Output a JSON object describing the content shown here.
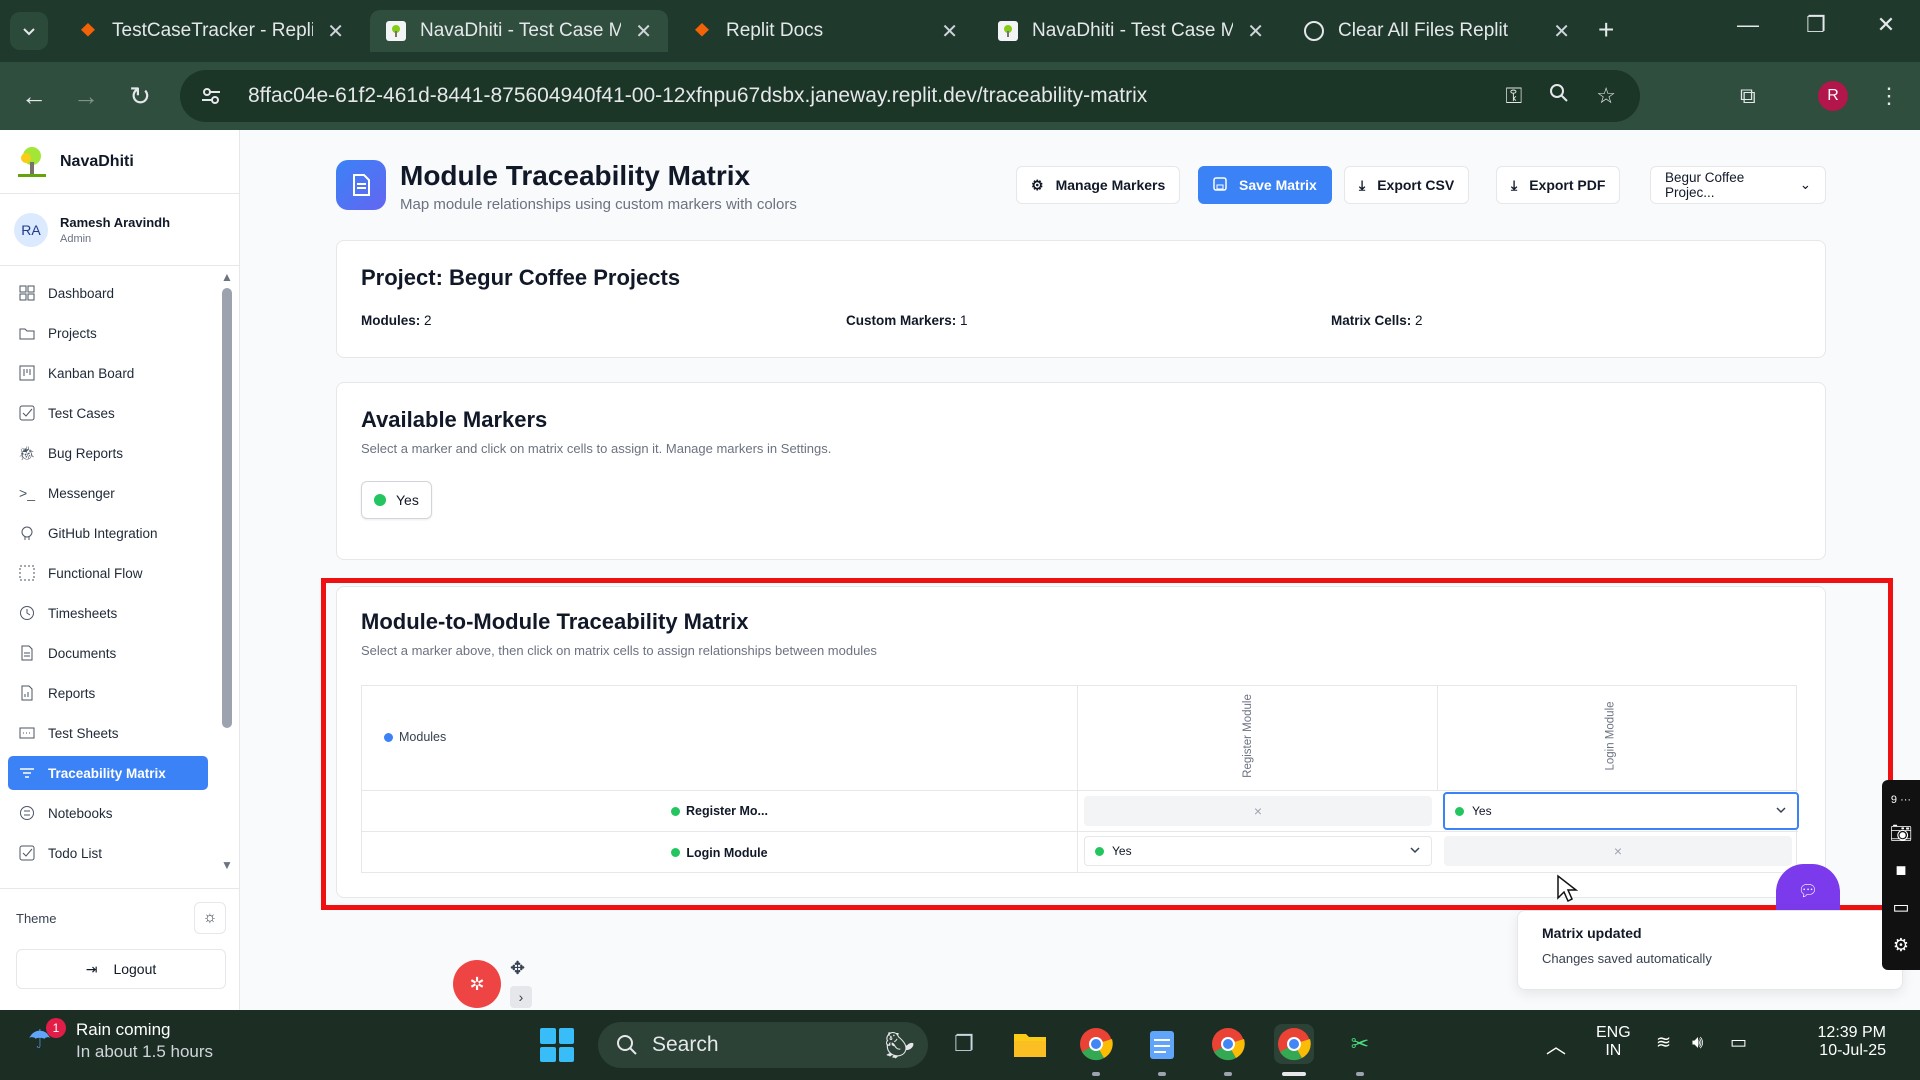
{
  "browser": {
    "tabs": [
      {
        "title": "TestCaseTracker - Replit",
        "favicon": "replit-icon"
      },
      {
        "title": "NavaDhiti - Test Case Ma",
        "favicon": "navadhiti-icon",
        "active": true
      },
      {
        "title": "Replit Docs",
        "favicon": "replit-icon"
      },
      {
        "title": "NavaDhiti - Test Case Ma",
        "favicon": "navadhiti-icon"
      },
      {
        "title": "Clear All Files Replit",
        "favicon": "chatgpt-icon"
      }
    ],
    "url": "8ffac04e-61f2-461d-8441-875604940f41-00-12xfnpu67dsbx.janeway.replit.dev/traceability-matrix",
    "profile_initial": "R"
  },
  "sidebar": {
    "brand": "NavaDhiti",
    "user": {
      "initials": "RA",
      "name": "Ramesh Aravindh",
      "role": "Admin"
    },
    "items": [
      {
        "label": "Dashboard",
        "icon": "grid-icon"
      },
      {
        "label": "Projects",
        "icon": "folder-icon"
      },
      {
        "label": "Kanban Board",
        "icon": "kanban-icon"
      },
      {
        "label": "Test Cases",
        "icon": "checkbox-icon"
      },
      {
        "label": "Bug Reports",
        "icon": "bug-icon"
      },
      {
        "label": "Messenger",
        "icon": "terminal-icon"
      },
      {
        "label": "GitHub Integration",
        "icon": "github-icon"
      },
      {
        "label": "Functional Flow",
        "icon": "flow-icon"
      },
      {
        "label": "Timesheets",
        "icon": "clock-icon"
      },
      {
        "label": "Documents",
        "icon": "document-icon"
      },
      {
        "label": "Reports",
        "icon": "report-icon"
      },
      {
        "label": "Test Sheets",
        "icon": "sheet-icon"
      },
      {
        "label": "Traceability Matrix",
        "icon": "filter-icon",
        "active": true
      },
      {
        "label": "Notebooks",
        "icon": "notebook-icon"
      },
      {
        "label": "Todo List",
        "icon": "todo-icon"
      }
    ],
    "theme_label": "Theme",
    "logout_label": "Logout"
  },
  "header": {
    "title": "Module Traceability Matrix",
    "subtitle": "Map module relationships using custom markers with colors",
    "buttons": {
      "manage_markers": "Manage Markers",
      "save_matrix": "Save Matrix",
      "export_csv": "Export CSV",
      "export_pdf": "Export PDF"
    },
    "project_select": "Begur Coffee Projec..."
  },
  "project_card": {
    "title": "Project: Begur Coffee Projects",
    "stats": [
      {
        "label": "Modules:",
        "value": "2"
      },
      {
        "label": "Custom Markers:",
        "value": "1"
      },
      {
        "label": "Matrix Cells:",
        "value": "2"
      }
    ]
  },
  "markers_card": {
    "title": "Available Markers",
    "description": "Select a marker and click on matrix cells to assign it. Manage markers in Settings.",
    "markers": [
      {
        "label": "Yes",
        "color": "#22c55e"
      }
    ]
  },
  "matrix_card": {
    "title": "Module-to-Module Traceability Matrix",
    "description": "Select a marker above, then click on matrix cells to assign relationships between modules",
    "corner_label": "Modules",
    "columns": [
      "Register Module",
      "Login Module"
    ],
    "rows": [
      {
        "label": "Register Mo...",
        "cells": [
          {
            "type": "empty",
            "symbol": "×"
          },
          {
            "type": "select",
            "value": "Yes"
          }
        ]
      },
      {
        "label": "Login Module",
        "cells": [
          {
            "type": "select",
            "value": "Yes"
          },
          {
            "type": "empty",
            "symbol": "×"
          }
        ]
      }
    ]
  },
  "toast": {
    "title": "Matrix updated",
    "description": "Changes saved automatically"
  },
  "side_rail_badge": "9 ···",
  "taskbar": {
    "weather_badge": "1",
    "weather_line1": "Rain coming",
    "weather_line2": "In about 1.5 hours",
    "search_placeholder": "Search",
    "lang_line1": "ENG",
    "lang_line2": "IN",
    "time": "12:39 PM",
    "date": "10-Jul-25"
  },
  "colors": {
    "primary": "#3b82f6",
    "marker_yes": "#22c55e",
    "highlight_border": "#ef1111",
    "chrome_bg": "#1f3a2c"
  }
}
